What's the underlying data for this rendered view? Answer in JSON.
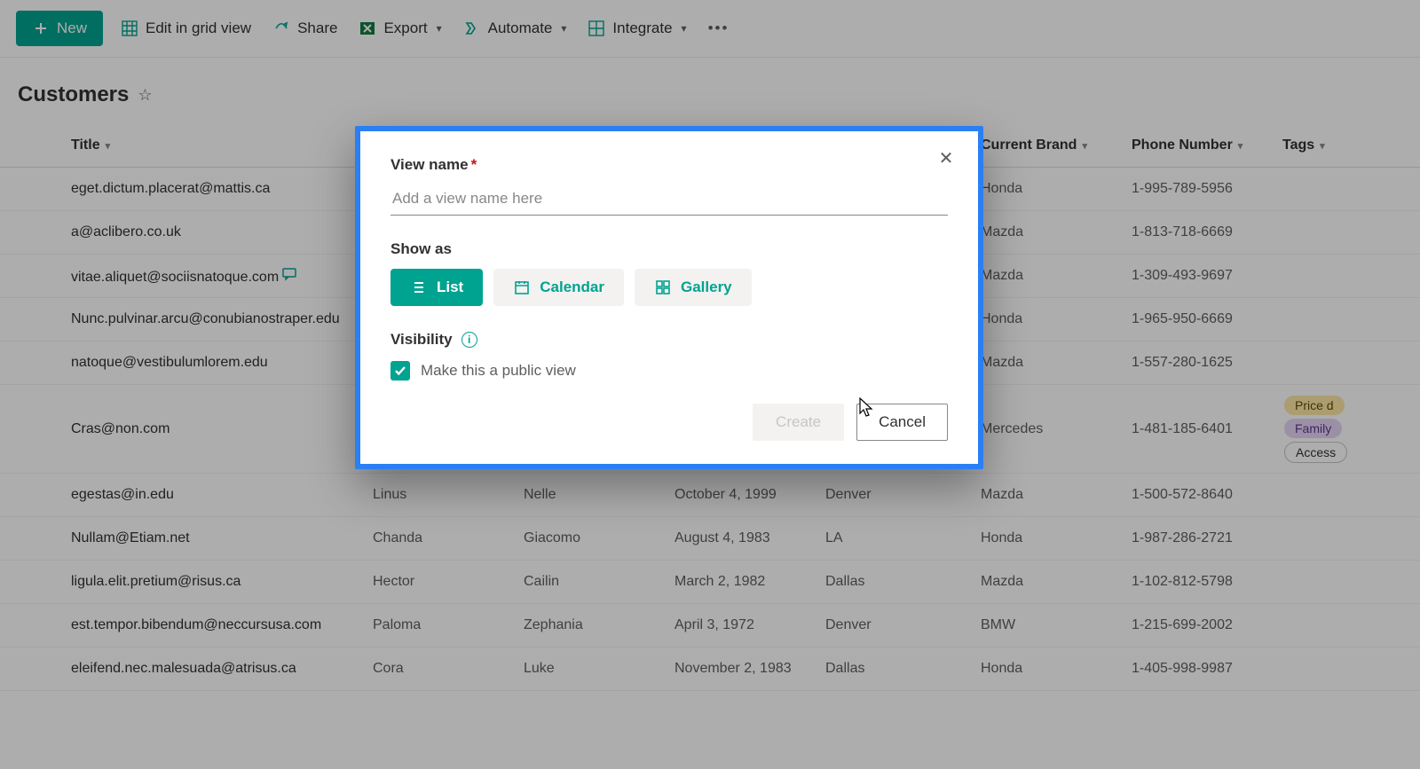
{
  "colors": {
    "accent": "#00a390",
    "highlight": "#2a7ff5"
  },
  "commandbar": {
    "new_label": "New",
    "edit_grid_label": "Edit in grid view",
    "share_label": "Share",
    "export_label": "Export",
    "automate_label": "Automate",
    "integrate_label": "Integrate"
  },
  "list": {
    "title": "Customers"
  },
  "columns": {
    "title": "Title",
    "first": "",
    "last": "",
    "date": "",
    "city": "",
    "brand": "Current Brand",
    "phone": "Phone Number",
    "tags": "Tags"
  },
  "rows": [
    {
      "title": "eget.dictum.placerat@mattis.ca",
      "first": "",
      "last": "",
      "date": "",
      "city": "",
      "brand": "Honda",
      "phone": "1-995-789-5956",
      "tags": []
    },
    {
      "title": "a@aclibero.co.uk",
      "first": "",
      "last": "",
      "date": "",
      "city": "",
      "brand": "Mazda",
      "phone": "1-813-718-6669",
      "tags": []
    },
    {
      "title": "vitae.aliquet@sociisnatoque.com",
      "first": "",
      "last": "",
      "date": "",
      "city": "",
      "brand": "Mazda",
      "phone": "1-309-493-9697",
      "tags": [],
      "has_comment": true
    },
    {
      "title": "Nunc.pulvinar.arcu@conubianostraper.edu",
      "first": "",
      "last": "",
      "date": "",
      "city": "",
      "brand": "Honda",
      "phone": "1-965-950-6669",
      "tags": []
    },
    {
      "title": "natoque@vestibulumlorem.edu",
      "first": "",
      "last": "",
      "date": "",
      "city": "",
      "brand": "Mazda",
      "phone": "1-557-280-1625",
      "tags": []
    },
    {
      "title": "Cras@non.com",
      "first": "",
      "last": "",
      "date": "",
      "city": "",
      "brand": "Mercedes",
      "phone": "1-481-185-6401",
      "tags": [
        "Price d",
        "Family",
        "Access"
      ]
    },
    {
      "title": "egestas@in.edu",
      "first": "Linus",
      "last": "Nelle",
      "date": "October 4, 1999",
      "city": "Denver",
      "brand": "Mazda",
      "phone": "1-500-572-8640",
      "tags": []
    },
    {
      "title": "Nullam@Etiam.net",
      "first": "Chanda",
      "last": "Giacomo",
      "date": "August 4, 1983",
      "city": "LA",
      "brand": "Honda",
      "phone": "1-987-286-2721",
      "tags": []
    },
    {
      "title": "ligula.elit.pretium@risus.ca",
      "first": "Hector",
      "last": "Cailin",
      "date": "March 2, 1982",
      "city": "Dallas",
      "brand": "Mazda",
      "phone": "1-102-812-5798",
      "tags": []
    },
    {
      "title": "est.tempor.bibendum@neccursusa.com",
      "first": "Paloma",
      "last": "Zephania",
      "date": "April 3, 1972",
      "city": "Denver",
      "brand": "BMW",
      "phone": "1-215-699-2002",
      "tags": []
    },
    {
      "title": "eleifend.nec.malesuada@atrisus.ca",
      "first": "Cora",
      "last": "Luke",
      "date": "November 2, 1983",
      "city": "Dallas",
      "brand": "Honda",
      "phone": "1-405-998-9987",
      "tags": []
    }
  ],
  "dialog": {
    "view_name_label": "View name",
    "view_name_placeholder": "Add a view name here",
    "show_as_label": "Show as",
    "options": {
      "list": "List",
      "calendar": "Calendar",
      "gallery": "Gallery"
    },
    "visibility_label": "Visibility",
    "public_checkbox_label": "Make this a public view",
    "create_label": "Create",
    "cancel_label": "Cancel"
  }
}
